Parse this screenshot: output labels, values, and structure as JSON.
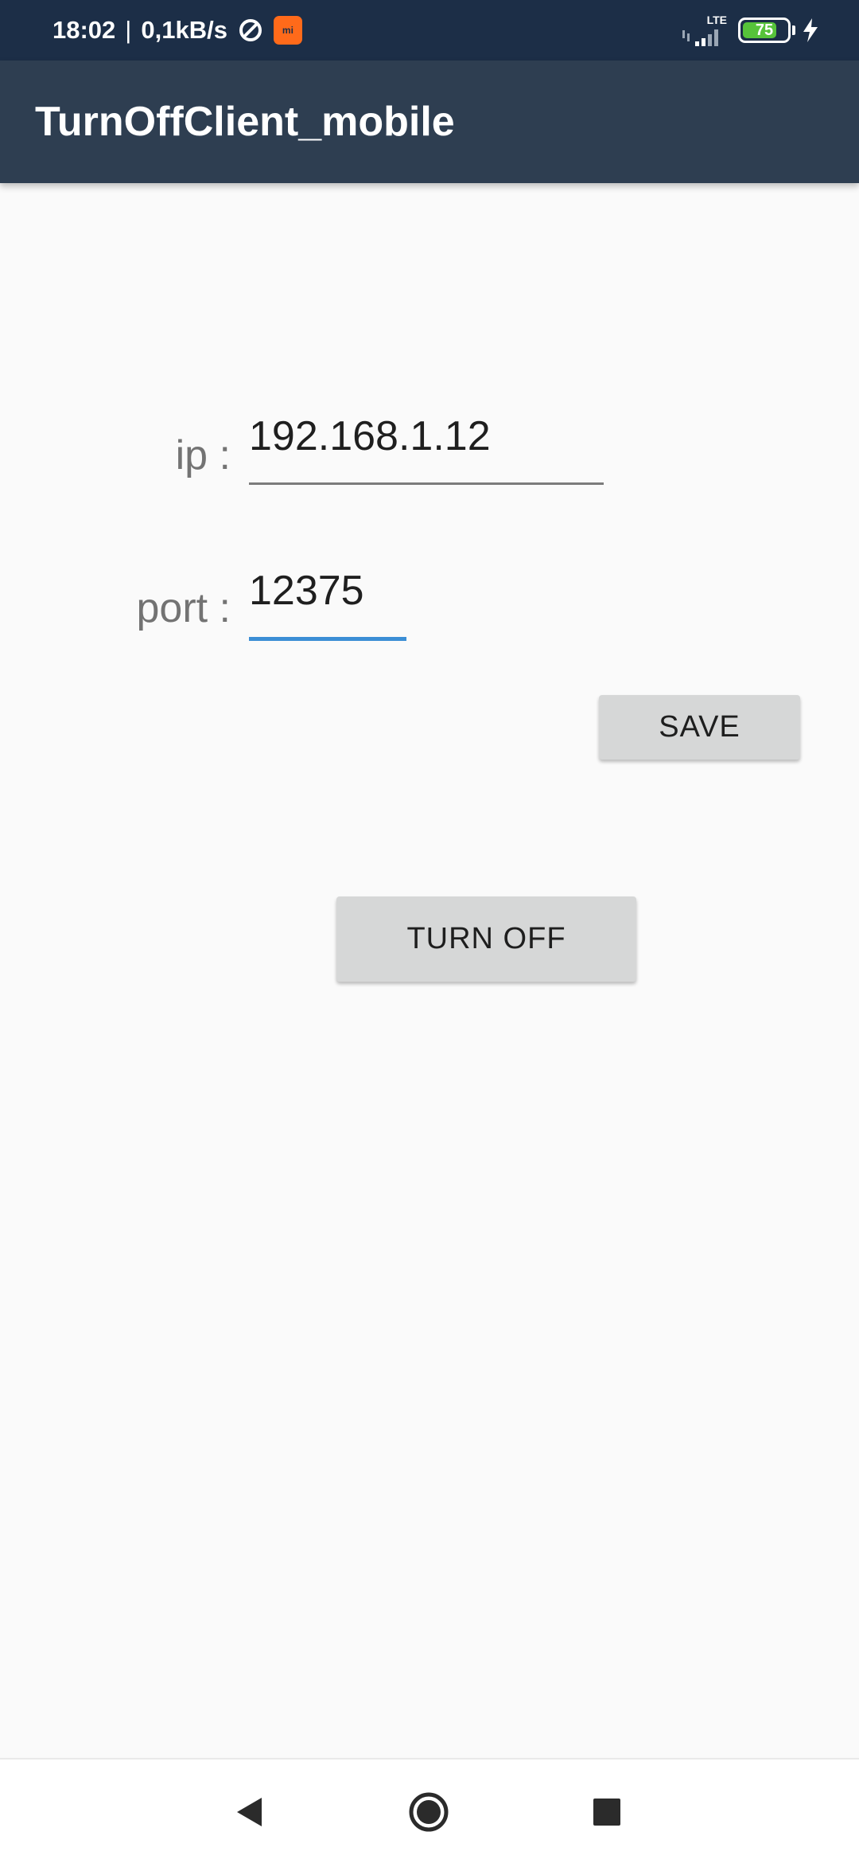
{
  "status_bar": {
    "time": "18:02",
    "separator": "|",
    "network_speed": "0,1kB/s",
    "network_type": "LTE",
    "battery_level": "75",
    "icons": [
      "sync-icon",
      "mi-app-icon",
      "signal-icon",
      "battery-icon",
      "charging-icon"
    ],
    "mi_icon_text": "mi"
  },
  "app_bar": {
    "title": "TurnOffClient_mobile"
  },
  "form": {
    "ip_label": "ip :",
    "ip_value": "192.168.1.12",
    "port_label": "port :",
    "port_value": "12375",
    "save_label": "SAVE",
    "turn_off_label": "TURN OFF"
  },
  "nav_bar": {
    "icons": [
      "back-icon",
      "home-icon",
      "recents-icon"
    ]
  },
  "colors": {
    "status_bar": "#1c2e47",
    "app_bar": "#2e3e51",
    "background": "#fafafa",
    "accent": "#3b8ed5",
    "button": "#d6d7d7",
    "battery": "#56c33a"
  }
}
